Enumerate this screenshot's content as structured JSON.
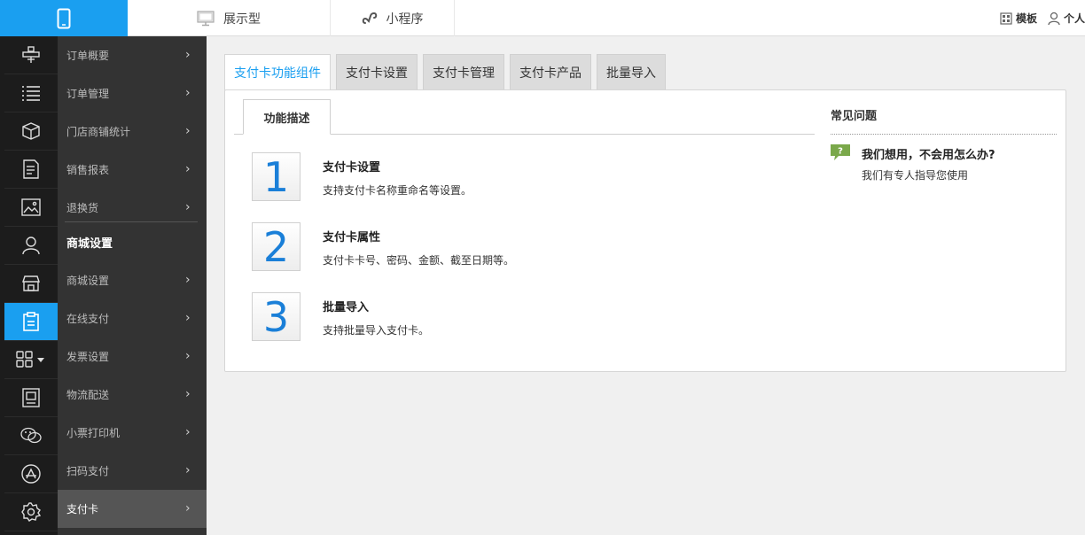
{
  "topbar": {
    "modes": [
      {
        "label": "展示型",
        "icon": "monitor-icon"
      },
      {
        "label": "小程序",
        "icon": "mini-program-icon"
      }
    ],
    "right_links": [
      {
        "label": "模板",
        "icon": "template-icon"
      },
      {
        "label": "个人",
        "icon": "user-icon"
      }
    ]
  },
  "submenu": {
    "items": [
      {
        "label": "订单概要"
      },
      {
        "label": "订单管理"
      },
      {
        "label": "门店商铺统计"
      },
      {
        "label": "销售报表"
      },
      {
        "label": "退换货"
      },
      {
        "label": "商城设置",
        "section": true
      },
      {
        "label": "商城设置"
      },
      {
        "label": "在线支付"
      },
      {
        "label": "发票设置"
      },
      {
        "label": "物流配送"
      },
      {
        "label": "小票打印机"
      },
      {
        "label": "扫码支付"
      },
      {
        "label": "支付卡",
        "active": true
      }
    ]
  },
  "tabs": [
    {
      "label": "支付卡功能组件",
      "active": true
    },
    {
      "label": "支付卡设置"
    },
    {
      "label": "支付卡管理"
    },
    {
      "label": "支付卡产品"
    },
    {
      "label": "批量导入"
    }
  ],
  "panel": {
    "subtab": "功能描述",
    "features": [
      {
        "num": "1",
        "title": "支付卡设置",
        "desc": "支持支付卡名称重命名等设置。"
      },
      {
        "num": "2",
        "title": "支付卡属性",
        "desc": "支付卡卡号、密码、金额、截至日期等。"
      },
      {
        "num": "3",
        "title": "批量导入",
        "desc": "支持批量导入支付卡。"
      }
    ],
    "faq": {
      "title": "常见问题",
      "question": "我们想用，不会用怎么办?",
      "answer": "我们有专人指导您使用"
    }
  },
  "colors": {
    "accent": "#1a9ff0",
    "rail_bg": "#1c1c1c",
    "submenu_bg": "#333333",
    "submenu_active": "#555555",
    "number_color": "#1a7fd8"
  }
}
